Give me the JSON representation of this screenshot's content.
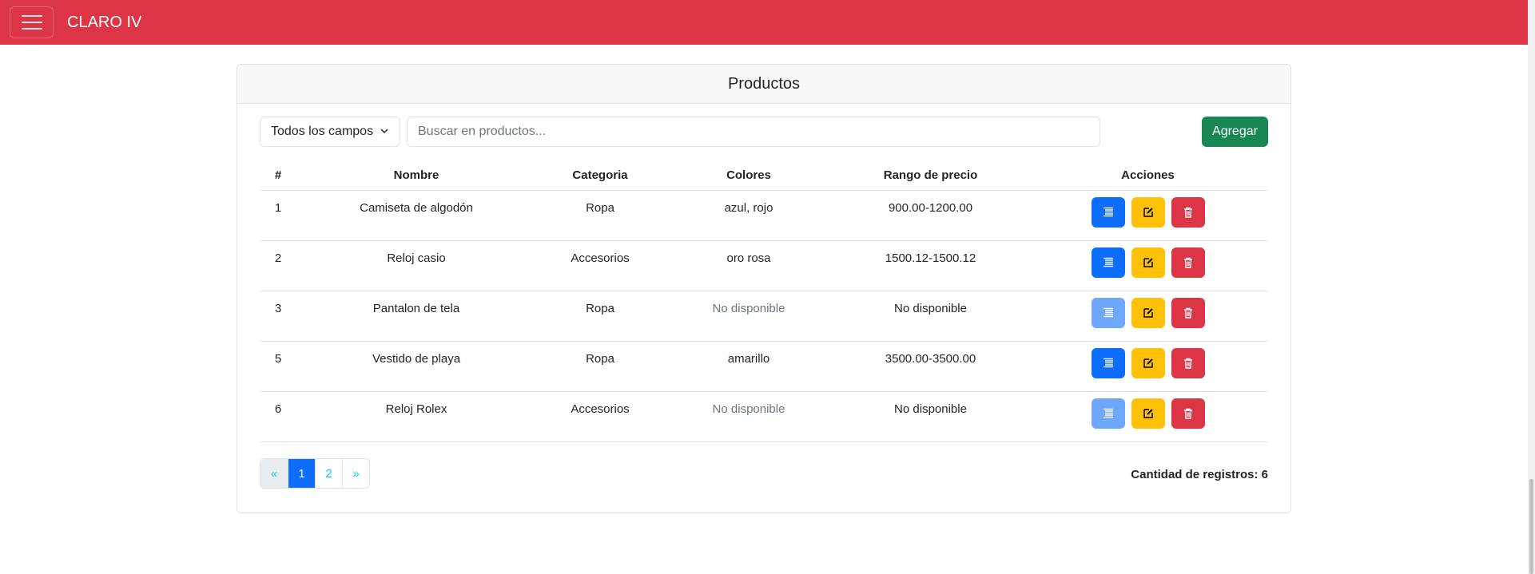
{
  "navbar": {
    "brand": "CLARO IV",
    "background": "#dc3545"
  },
  "card": {
    "title": "Productos",
    "filter": {
      "selected": "Todos los campos"
    },
    "search": {
      "placeholder": "Buscar en productos...",
      "value": ""
    },
    "add_label": "Agregar"
  },
  "table": {
    "headers": [
      "#",
      "Nombre",
      "Categoria",
      "Colores",
      "Rango de precio",
      "Acciones"
    ],
    "rows": [
      {
        "id": "1",
        "nombre": "Camiseta de algodón",
        "categoria": "Ropa",
        "colores": "azul, rojo",
        "rango": "900.00-1200.00",
        "detail_enabled": true
      },
      {
        "id": "2",
        "nombre": "Reloj casio",
        "categoria": "Accesorios",
        "colores": "oro rosa",
        "rango": "1500.12-1500.12",
        "detail_enabled": true
      },
      {
        "id": "3",
        "nombre": "Pantalon de tela",
        "categoria": "Ropa",
        "colores": "No disponible",
        "rango": "No disponible",
        "detail_enabled": false
      },
      {
        "id": "5",
        "nombre": "Vestido de playa",
        "categoria": "Ropa",
        "colores": "amarillo",
        "rango": "3500.00-3500.00",
        "detail_enabled": true
      },
      {
        "id": "6",
        "nombre": "Reloj Rolex",
        "categoria": "Accesorios",
        "colores": "No disponible",
        "rango": "No disponible",
        "detail_enabled": false
      }
    ],
    "actions": {
      "detail_icon": "list-icon",
      "edit_icon": "edit-icon",
      "delete_icon": "trash-icon"
    }
  },
  "pagination": {
    "prev": "«",
    "pages": [
      "1",
      "2"
    ],
    "active": "1",
    "next": "»"
  },
  "footer": {
    "record_count": "Cantidad de registros: 6"
  },
  "colors": {
    "primary": "#0d6efd",
    "warning": "#ffc107",
    "danger": "#dc3545",
    "success": "#198754"
  }
}
